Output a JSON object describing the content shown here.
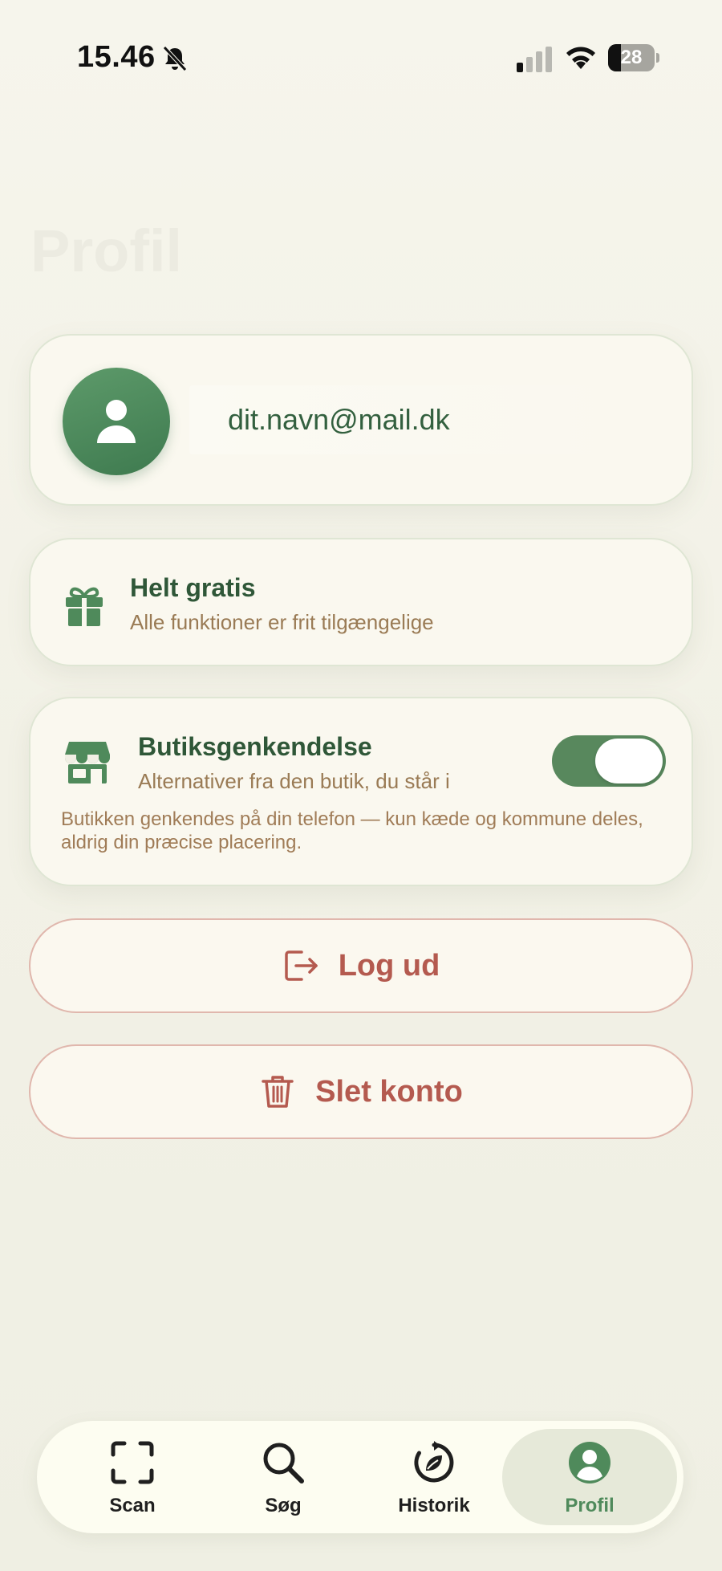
{
  "status_bar": {
    "time": "15.46",
    "battery": "28",
    "battery_level": 0.28
  },
  "page": {
    "title": "Profil"
  },
  "profile": {
    "email": "dit.navn@mail.dk"
  },
  "free_plan": {
    "title": "Helt gratis",
    "subtitle": "Alle funktioner er frit tilgængelige"
  },
  "store_recognition": {
    "title": "Butiksgenkendelse",
    "subtitle": "Alternativer fra den butik, du står i",
    "description": "Butikken genkendes på din telefon — kun kæde og kommune deles, aldrig din præcise placering.",
    "enabled": true
  },
  "actions": {
    "logout_label": "Log ud",
    "delete_label": "Slet konto"
  },
  "tab_bar": {
    "items": [
      {
        "label": "Scan",
        "icon": "scan-icon"
      },
      {
        "label": "Søg",
        "icon": "search-icon"
      },
      {
        "label": "Historik",
        "icon": "history-icon"
      },
      {
        "label": "Profil",
        "icon": "profile-icon",
        "active": true
      }
    ]
  },
  "colors": {
    "primary_green": "#4f8a5b",
    "destructive": "#b45a4f",
    "muted_text": "#9a7b55"
  }
}
